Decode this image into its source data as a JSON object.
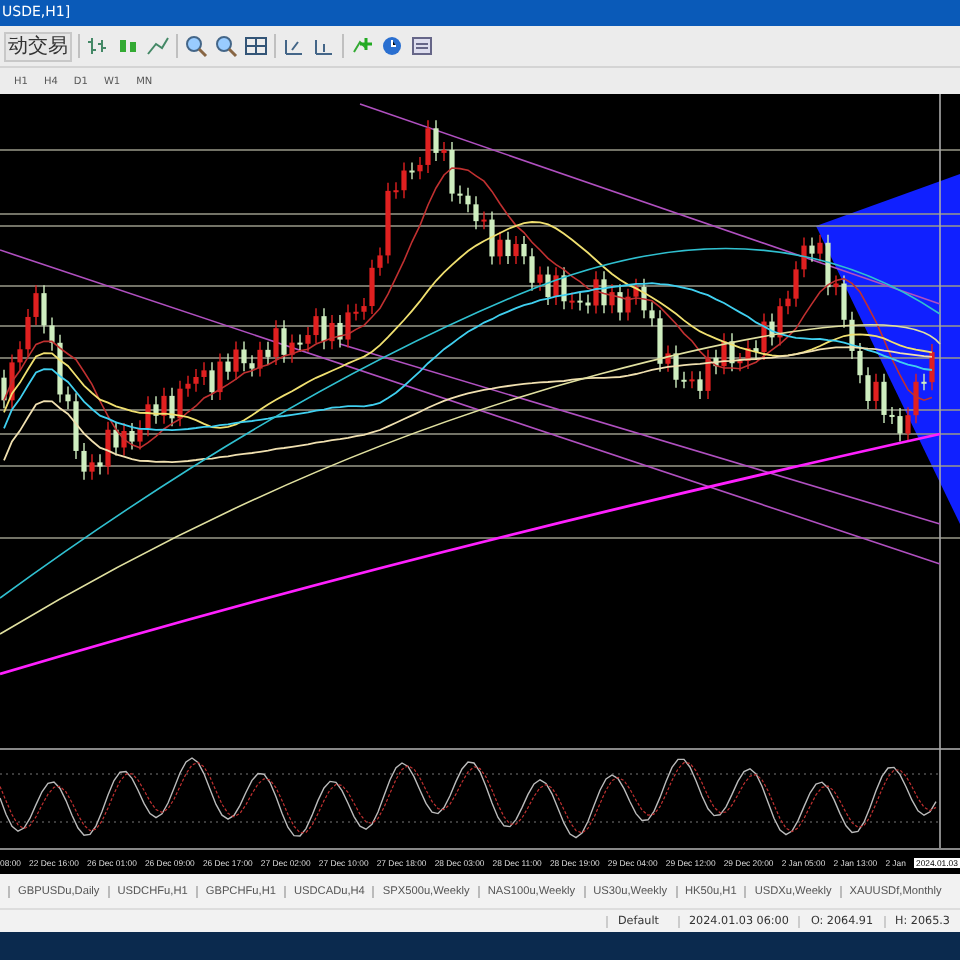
{
  "window": {
    "title": "USDE,H1]"
  },
  "toolbar": {
    "autotrade_label": "动交易"
  },
  "timeframes": [
    {
      "label": "H1"
    },
    {
      "label": "H4"
    },
    {
      "label": "D1"
    },
    {
      "label": "W1"
    },
    {
      "label": "MN"
    }
  ],
  "time_axis": {
    "labels": [
      "08:00",
      "22 Dec 16:00",
      "26 Dec 01:00",
      "26 Dec 09:00",
      "26 Dec 17:00",
      "27 Dec 02:00",
      "27 Dec 10:00",
      "27 Dec 18:00",
      "28 Dec 03:00",
      "28 Dec 11:00",
      "28 Dec 19:00",
      "29 Dec 04:00",
      "29 Dec 12:00",
      "29 Dec 20:00",
      "2 Jan 05:00",
      "2 Jan 13:00",
      "2 Jan"
    ],
    "cursor_label": "2024.01.03"
  },
  "symbol_tabs": [
    {
      "label": "GBPUSDu,Daily"
    },
    {
      "label": "USDCHFu,H1"
    },
    {
      "label": "GBPCHFu,H1"
    },
    {
      "label": "USDCADu,H4"
    },
    {
      "label": "SPX500u,Weekly"
    },
    {
      "label": "NAS100u,Weekly"
    },
    {
      "label": "US30u,Weekly"
    },
    {
      "label": "HK50u,H1"
    },
    {
      "label": "USDXu,Weekly"
    },
    {
      "label": "XAUUSDf,Monthly"
    }
  ],
  "status_bar": [
    "Default",
    "2024.01.03 06:00",
    "O: 2064.91",
    "H: 2065.3"
  ]
}
